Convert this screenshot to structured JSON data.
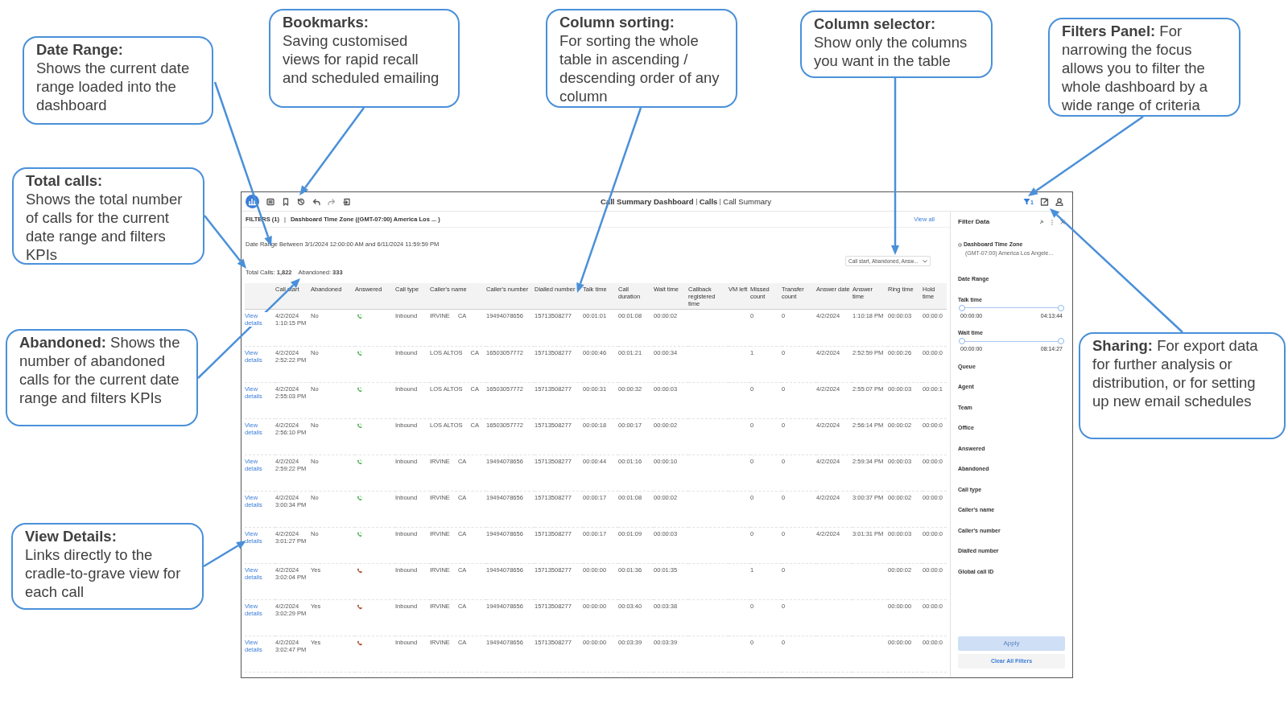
{
  "toolbar": {
    "breadcrumbs": [
      "Call Summary Dashboard",
      "Calls",
      "Call Summary"
    ],
    "filter_active": true,
    "filter_badge": "1"
  },
  "filters_bar": {
    "label": "FILTERS (1)",
    "separator": "|",
    "summary": "Dashboard Time Zone ((GMT-07:00) America Los ... )",
    "link": "View all"
  },
  "date_range": "Date Range Between 3/1/2024 12:00:00 AM and 6/11/2024 11:59:59 PM",
  "totals": [
    "Total Calls: **1,822**",
    "Abandoned: **333**"
  ],
  "column_selector": {
    "value": "Call start, Abandoned, Answ..."
  },
  "table": {
    "columns": [
      "Call start",
      "Abandoned",
      "Answered",
      "Call type",
      "Caller's name",
      "Caller's number",
      "Dialled number",
      "Talk time",
      "Call duration",
      "Wait time",
      "Callback registered time",
      "VM left",
      "Missed count",
      "Transfer count",
      "Answer date",
      "Answer time",
      "Ring time",
      "Hold time"
    ],
    "rows": [
      {
        "link": "View details",
        "call_start": "4/2/2024 1:10:15 PM",
        "abandoned": "No",
        "answered": true,
        "call_type": "Inbound",
        "city": "IRVINE",
        "state": "CA",
        "callers_number": "19494078656",
        "dialled_number": "15713508277",
        "talk_time": "00:01:01",
        "call_duration": "00:01:08",
        "wait_time": "00:00:02",
        "missed_count": "0",
        "transfer_count": "0",
        "answer_date": "4/2/2024",
        "answer_time": "1:10:18 PM",
        "ring_time": "00:00:03",
        "hold_time": "00:00:0"
      },
      {
        "link": "View details",
        "call_start": "4/2/2024 2:52:22 PM",
        "abandoned": "No",
        "answered": true,
        "call_type": "Inbound",
        "city": "LOS ALTOS",
        "state": "CA",
        "callers_number": "16503057772",
        "dialled_number": "15713508277",
        "talk_time": "00:00:46",
        "call_duration": "00:01:21",
        "wait_time": "00:00:34",
        "missed_count": "1",
        "transfer_count": "0",
        "answer_date": "4/2/2024",
        "answer_time": "2:52:59 PM",
        "ring_time": "00:00:26",
        "hold_time": "00:00:0"
      },
      {
        "link": "View details",
        "call_start": "4/2/2024 2:55:03 PM",
        "abandoned": "No",
        "answered": true,
        "call_type": "Inbound",
        "city": "LOS ALTOS",
        "state": "CA",
        "callers_number": "16503057772",
        "dialled_number": "15713508277",
        "talk_time": "00:00:31",
        "call_duration": "00:00:32",
        "wait_time": "00:00:03",
        "missed_count": "0",
        "transfer_count": "0",
        "answer_date": "4/2/2024",
        "answer_time": "2:55:07 PM",
        "ring_time": "00:00:03",
        "hold_time": "00:00:1"
      },
      {
        "link": "View details",
        "call_start": "4/2/2024 2:56:10 PM",
        "abandoned": "No",
        "answered": true,
        "call_type": "Inbound",
        "city": "LOS ALTOS",
        "state": "CA",
        "callers_number": "16503057772",
        "dialled_number": "15713508277",
        "talk_time": "00:00:18",
        "call_duration": "00:00:17",
        "wait_time": "00:00:02",
        "missed_count": "0",
        "transfer_count": "0",
        "answer_date": "4/2/2024",
        "answer_time": "2:56:14 PM",
        "ring_time": "00:00:02",
        "hold_time": "00:00:0"
      },
      {
        "link": "View details",
        "call_start": "4/2/2024 2:59:22 PM",
        "abandoned": "No",
        "answered": true,
        "call_type": "Inbound",
        "city": "IRVINE",
        "state": "CA",
        "callers_number": "19494078656",
        "dialled_number": "15713508277",
        "talk_time": "00:00:44",
        "call_duration": "00:01:16",
        "wait_time": "00:00:10",
        "missed_count": "0",
        "transfer_count": "0",
        "answer_date": "4/2/2024",
        "answer_time": "2:59:34 PM",
        "ring_time": "00:00:03",
        "hold_time": "00:00:0"
      },
      {
        "link": "View details",
        "call_start": "4/2/2024 3:00:34 PM",
        "abandoned": "No",
        "answered": true,
        "call_type": "Inbound",
        "city": "IRVINE",
        "state": "CA",
        "callers_number": "19494078656",
        "dialled_number": "15713508277",
        "talk_time": "00:00:17",
        "call_duration": "00:01:08",
        "wait_time": "00:00:02",
        "missed_count": "0",
        "transfer_count": "0",
        "answer_date": "4/2/2024",
        "answer_time": "3:00:37 PM",
        "ring_time": "00:00:02",
        "hold_time": "00:00:0"
      },
      {
        "link": "View details",
        "call_start": "4/2/2024 3:01:27 PM",
        "abandoned": "No",
        "answered": true,
        "call_type": "Inbound",
        "city": "IRVINE",
        "state": "CA",
        "callers_number": "19494078656",
        "dialled_number": "15713508277",
        "talk_time": "00:00:17",
        "call_duration": "00:01:09",
        "wait_time": "00:00:03",
        "missed_count": "0",
        "transfer_count": "0",
        "answer_date": "4/2/2024",
        "answer_time": "3:01:31 PM",
        "ring_time": "00:00:03",
        "hold_time": "00:00:0"
      },
      {
        "link": "View details",
        "call_start": "4/2/2024 3:02:04 PM",
        "abandoned": "Yes",
        "answered": false,
        "call_type": "Inbound",
        "city": "IRVINE",
        "state": "CA",
        "callers_number": "19494078656",
        "dialled_number": "15713508277",
        "talk_time": "00:00:00",
        "call_duration": "00:01:36",
        "wait_time": "00:01:35",
        "missed_count": "1",
        "transfer_count": "0",
        "ring_time": "00:00:02",
        "hold_time": "00:00:0"
      },
      {
        "link": "View details",
        "call_start": "4/2/2024 3:02:29 PM",
        "abandoned": "Yes",
        "answered": false,
        "call_type": "Inbound",
        "city": "IRVINE",
        "state": "CA",
        "callers_number": "19494078656",
        "dialled_number": "15713508277",
        "talk_time": "00:00:00",
        "call_duration": "00:03:40",
        "wait_time": "00:03:38",
        "missed_count": "0",
        "transfer_count": "0",
        "ring_time": "00:00:00",
        "hold_time": "00:00:0"
      },
      {
        "link": "View details",
        "call_start": "4/2/2024 3:02:47 PM",
        "abandoned": "Yes",
        "answered": false,
        "call_type": "Inbound",
        "city": "IRVINE",
        "state": "CA",
        "callers_number": "19494078656",
        "dialled_number": "15713508277",
        "talk_time": "00:00:00",
        "call_duration": "00:03:39",
        "wait_time": "00:03:39",
        "missed_count": "0",
        "transfer_count": "0",
        "ring_time": "00:00:00",
        "hold_time": "00:00:0"
      }
    ]
  },
  "filter_panel": {
    "title": "Filter Data",
    "items": [
      {
        "kind": "timezone",
        "label": "Dashboard Time Zone",
        "value": "(GMT-07:00) America Los Angele..."
      },
      {
        "kind": "label",
        "label": "Date Range"
      },
      {
        "kind": "slider",
        "label": "Talk time",
        "level": 1,
        "min": "00:00:00",
        "max": "04:13:44"
      },
      {
        "kind": "slider",
        "label": "Wait time",
        "level": 1,
        "min": "00:00:00",
        "max": "08:14:27"
      },
      {
        "kind": "label",
        "label": "Queue"
      },
      {
        "kind": "label",
        "label": "Agent"
      },
      {
        "kind": "label",
        "label": "Team"
      },
      {
        "kind": "label",
        "label": "Office"
      },
      {
        "kind": "label",
        "label": "Answered"
      },
      {
        "kind": "label",
        "label": "Abandoned"
      },
      {
        "kind": "label",
        "label": "Call type"
      },
      {
        "kind": "label",
        "label": "Caller's name"
      },
      {
        "kind": "label",
        "label": "Caller's number"
      },
      {
        "kind": "label",
        "label": "Dialled number"
      },
      {
        "kind": "label",
        "label": "Global call ID"
      }
    ],
    "apply": {
      "label": "Apply",
      "disabled": true
    },
    "clear": "Clear All Filters"
  },
  "callouts": [
    {
      "title": "Date Range:",
      "text": "Shows the current date range loaded into the dashboard"
    },
    {
      "title": "Bookmarks:",
      "text": "Saving customised views for rapid recall and scheduled emailing"
    },
    {
      "title": "Column sorting:",
      "text": "For sorting the whole table in ascending / descending order of any column"
    },
    {
      "title": "Column selector:",
      "text": "Show only the columns you want in the table"
    },
    {
      "text": "**Filters Panel:** For narrowing the focus allows you to filter the whole dashboard by a wide range of criteria"
    },
    {
      "title": "Total calls:",
      "text": "Shows the total number of calls for the current date range and filters KPIs"
    },
    {
      "text": "**Abandoned:** Shows the number of abandoned calls for the current date range and filters KPIs"
    },
    {
      "title": "View Details:",
      "text": "Links directly to the cradle-to-grave view for each call"
    },
    {
      "text": "**Sharing:** For export data for further analysis or distribution, or for setting up new email schedules"
    }
  ]
}
